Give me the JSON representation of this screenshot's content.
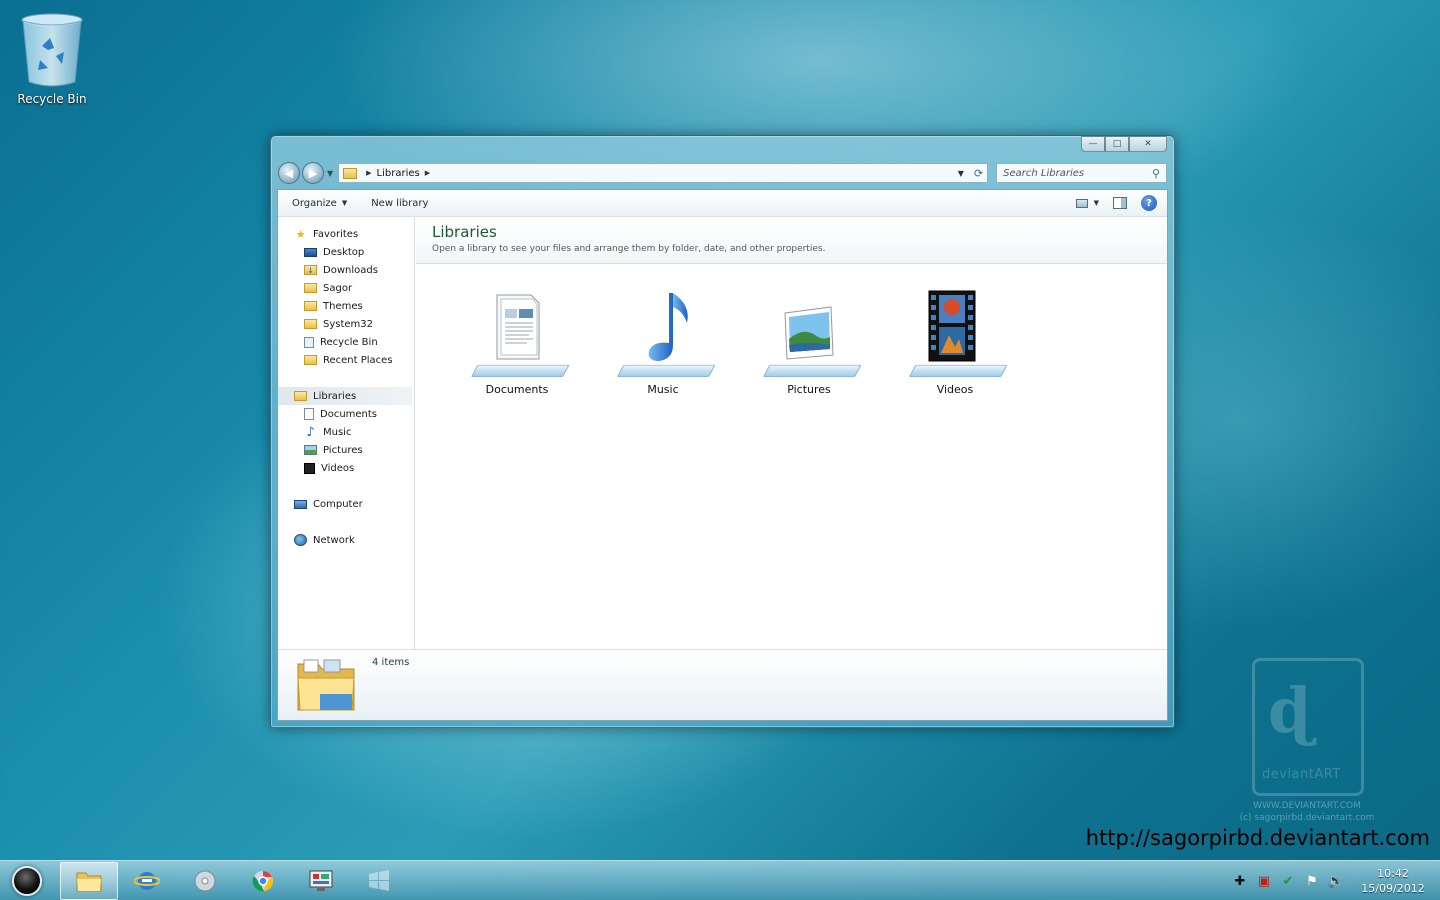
{
  "desktop": {
    "icons": [
      {
        "label": "Recycle Bin",
        "icon": "recycle-bin-icon"
      }
    ]
  },
  "window": {
    "caption_buttons": {
      "minimize": "—",
      "maximize": "□",
      "close": "✕"
    },
    "address": {
      "crumbs": [
        "Libraries"
      ],
      "icon": "folder-icon"
    },
    "search": {
      "placeholder": "Search Libraries"
    },
    "toolbar": {
      "organize_label": "Organize",
      "new_library_label": "New library",
      "help_label": "?"
    },
    "nav": {
      "favorites": {
        "label": "Favorites",
        "items": [
          {
            "label": "Desktop",
            "icon": "desktop-icon"
          },
          {
            "label": "Downloads",
            "icon": "downloads-icon"
          },
          {
            "label": "Sagor",
            "icon": "user-folder-icon"
          },
          {
            "label": "Themes",
            "icon": "folder-icon"
          },
          {
            "label": "System32",
            "icon": "folder-icon"
          },
          {
            "label": "Recycle Bin",
            "icon": "recycle-bin-icon"
          },
          {
            "label": "Recent Places",
            "icon": "recent-places-icon"
          }
        ]
      },
      "libraries": {
        "label": "Libraries",
        "items": [
          {
            "label": "Documents",
            "icon": "documents-icon"
          },
          {
            "label": "Music",
            "icon": "music-icon"
          },
          {
            "label": "Pictures",
            "icon": "pictures-icon"
          },
          {
            "label": "Videos",
            "icon": "videos-icon"
          }
        ]
      },
      "computer": {
        "label": "Computer"
      },
      "network": {
        "label": "Network"
      }
    },
    "content": {
      "title": "Libraries",
      "subtitle": "Open a library to see your files and arrange them by folder, date, and other properties.",
      "libraries": [
        {
          "label": "Documents",
          "icon": "documents-library-icon"
        },
        {
          "label": "Music",
          "icon": "music-library-icon"
        },
        {
          "label": "Pictures",
          "icon": "pictures-library-icon"
        },
        {
          "label": "Videos",
          "icon": "videos-library-icon"
        }
      ]
    },
    "details": {
      "count": "4 items"
    }
  },
  "watermark": {
    "brand": "deviantART",
    "url_line1": "WWW.DEVIANTART.COM",
    "url_line2": "(c) sagorpirbd.deviantart.com"
  },
  "site_url": "http://sagorpirbd.deviantart.com",
  "taskbar": {
    "pinned": [
      {
        "name": "explorer",
        "icon": "folder-icon",
        "active": true
      },
      {
        "name": "internet-explorer",
        "icon": "ie-icon",
        "active": false
      },
      {
        "name": "media-player",
        "icon": "media-player-icon",
        "active": false
      },
      {
        "name": "chrome",
        "icon": "chrome-icon",
        "active": false
      },
      {
        "name": "control-panel",
        "icon": "control-panel-icon",
        "active": false
      },
      {
        "name": "windows",
        "icon": "windows-icon",
        "active": false
      }
    ],
    "clock": {
      "time": "10:42",
      "date": "15/09/2012"
    }
  }
}
